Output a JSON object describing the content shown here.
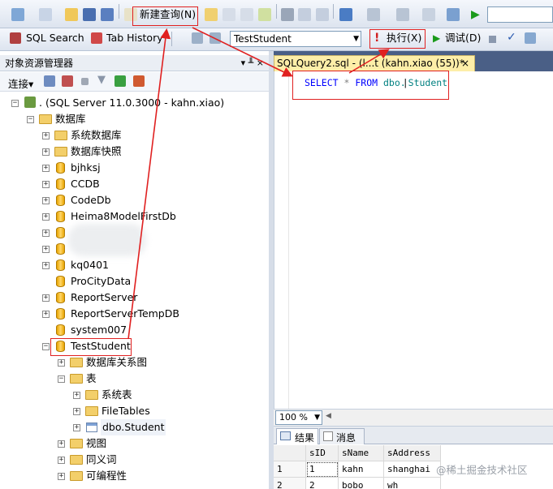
{
  "toolbar1": {
    "new_query": "新建查询(N)"
  },
  "toolbar2": {
    "sql_search": "SQL Search",
    "tab_history": "Tab History",
    "database": "TestStudent",
    "execute": "执行(X)",
    "debug": "调试(D)"
  },
  "object_explorer": {
    "title": "对象资源管理器",
    "pin": "▾ ╨ ×",
    "connect": "连接▾",
    "server": ". (SQL Server 11.0.3000 - kahn.xiao)",
    "databases": "数据库",
    "items": [
      {
        "label": "系统数据库",
        "kind": "folder"
      },
      {
        "label": "数据库快照",
        "kind": "folder"
      },
      {
        "label": "bjhksj",
        "kind": "db"
      },
      {
        "label": "CCDB",
        "kind": "db"
      },
      {
        "label": "CodeDb",
        "kind": "db"
      },
      {
        "label": "Heima8ModelFirstDb",
        "kind": "db"
      },
      {
        "label": "",
        "kind": "db"
      },
      {
        "label": "",
        "kind": "db"
      },
      {
        "label": "kq0401",
        "kind": "db"
      },
      {
        "label": "ProCityData",
        "kind": "db"
      },
      {
        "label": "ReportServer",
        "kind": "db"
      },
      {
        "label": "ReportServerTempDB",
        "kind": "db"
      },
      {
        "label": "system007",
        "kind": "db"
      },
      {
        "label": "TestStudent",
        "kind": "db"
      }
    ],
    "teststudent_children": {
      "diagrams": "数据库关系图",
      "tables": "表",
      "system_tables": "系统表",
      "file_tables": "FileTables",
      "dbo_student": "dbo.Student",
      "views": "视图",
      "synonyms": "同义词",
      "programmability": "可编程性"
    }
  },
  "editor": {
    "tab_title": "SQLQuery2.sql - (l...t (kahn.xiao (55))*",
    "tab_close": "×",
    "sql_keyword_select": "SELECT",
    "sql_star": "*",
    "sql_keyword_from": "FROM",
    "sql_table_prefix": "dbo.",
    "sql_table_name": "Student",
    "zoom": "100 %"
  },
  "results": {
    "tab_results": "结果",
    "tab_messages": "消息",
    "columns": [
      "sID",
      "sName",
      "sAddress"
    ],
    "rows": [
      {
        "num": "1",
        "sID": "1",
        "sName": "kahn",
        "sAddress": "shanghai"
      },
      {
        "num": "2",
        "sID": "2",
        "sName": "bobo",
        "sAddress": "wh"
      }
    ]
  },
  "watermark": "@稀土掘金技术社区"
}
